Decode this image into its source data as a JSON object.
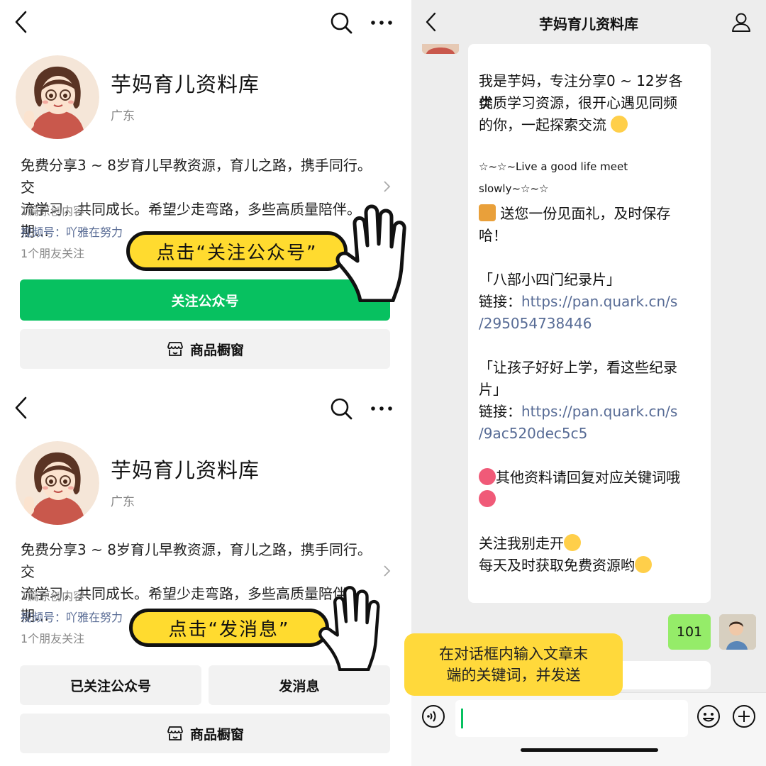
{
  "profile_top": {
    "name": "芋妈育儿资料库",
    "location": "广东",
    "desc_line1": "免费分享3 ~ 8岁育儿早教资源，育儿之路，携手同行。交",
    "desc_line2": "流学习，共同成长。希望少走弯路，多些高质量陪伴。期…",
    "original_count": "1篇原创内容",
    "channel": "视频号：吖雅在努力",
    "friends": "1个朋友关注",
    "follow_label": "关注公众号",
    "shop_label": "商品橱窗",
    "callout": "点击“关注公众号”"
  },
  "profile_bottom": {
    "name": "芋妈育儿资料库",
    "location": "广东",
    "desc_line1": "免费分享3 ~ 8岁育儿早教资源，育儿之路，携手同行。交",
    "desc_line2": "流学习，共同成长。希望少走弯路，多些高质量陪伴。期…",
    "original_count": "1篇原创内容",
    "channel": "视频号：吖雅在努力",
    "friends": "1个朋友关注",
    "followed_label": "已关注公众号",
    "message_label": "发消息",
    "shop_label": "商品橱窗",
    "callout": "点击“发消息”"
  },
  "chat": {
    "title": "芋妈育儿资料库",
    "intro_1": "我是芋妈，专注分享0 ~ 12岁各类",
    "intro_2": "优质学习资源，很开心遇见同频",
    "intro_3": "的你，一起探索交流",
    "motto_1": "☆~☆~Live a good life meet",
    "motto_2": "slowly~☆~☆",
    "gift_1": " 送您一份见面礼，及时保存",
    "gift_2": "哈！",
    "res1_title": "「八部小四门纪录片」",
    "res1_link_label": "链接：",
    "res1_link_a": "https://pan.quark.cn/s",
    "res1_link_b": "/295054738446",
    "res2_title_1": "「让孩子好好上学，看这些纪录",
    "res2_title_2": "片」",
    "res2_link_label": "链接：",
    "res2_link_a": "https://pan.quark.cn/s",
    "res2_link_b": "/9ac520dec5c5",
    "other": "其他资料请回复对应关键词哦",
    "follow_me": "关注我别走开",
    "daily": "每天及时获取免费资源哟",
    "my_message": "101",
    "tooltip_1": "在对话框内输入文章末",
    "tooltip_2": "端的关键词，并发送"
  },
  "icons": {
    "back": "chevron-left-icon",
    "search": "search-icon",
    "more": "more-dots-icon",
    "user": "user-icon",
    "shop": "shop-awning-icon",
    "voice": "voice-icon",
    "emoji": "smile-icon",
    "plus": "plus-icon",
    "hand": "pointing-hand-icon"
  },
  "colors": {
    "wechat_green": "#07c160",
    "callout_yellow": "#ffdb2f",
    "link_blue": "#576b95",
    "my_bubble": "#95ec69"
  }
}
